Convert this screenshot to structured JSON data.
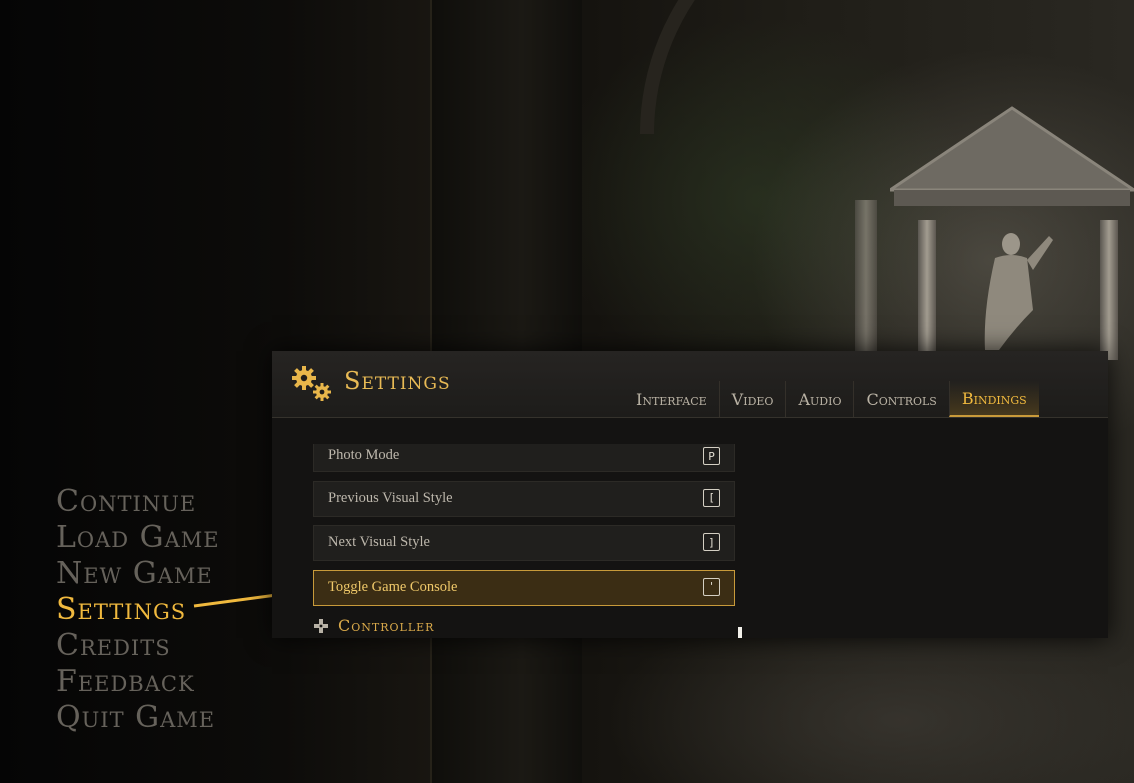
{
  "main_menu": {
    "items": [
      {
        "label": "Continue"
      },
      {
        "label": "Load Game"
      },
      {
        "label": "New Game"
      },
      {
        "label": "Settings"
      },
      {
        "label": "Credits"
      },
      {
        "label": "Feedback"
      },
      {
        "label": "Quit Game"
      }
    ],
    "active_label": "Settings"
  },
  "settings": {
    "title": "Settings",
    "tabs": [
      {
        "label": "Interface"
      },
      {
        "label": "Video"
      },
      {
        "label": "Audio"
      },
      {
        "label": "Controls"
      },
      {
        "label": "Bindings"
      }
    ],
    "active_tab": "Bindings",
    "bindings": [
      {
        "action": "Photo Mode",
        "key": "P"
      },
      {
        "action": "Previous Visual Style",
        "key": "["
      },
      {
        "action": "Next Visual Style",
        "key": "]"
      },
      {
        "action": "Toggle Game Console",
        "key": "'"
      }
    ],
    "selected_binding": "Toggle Game Console",
    "section_header": "Controller"
  },
  "colors": {
    "accent_gold": "#f0b93e",
    "menu_inactive": "#66625b",
    "panel_bg": "#141312",
    "selected_row_bg": "#3b2d14"
  },
  "icons": {
    "settings_header": "gears-icon",
    "controller_section": "dpad-icon",
    "menu_pointer": "arrow-icon"
  }
}
